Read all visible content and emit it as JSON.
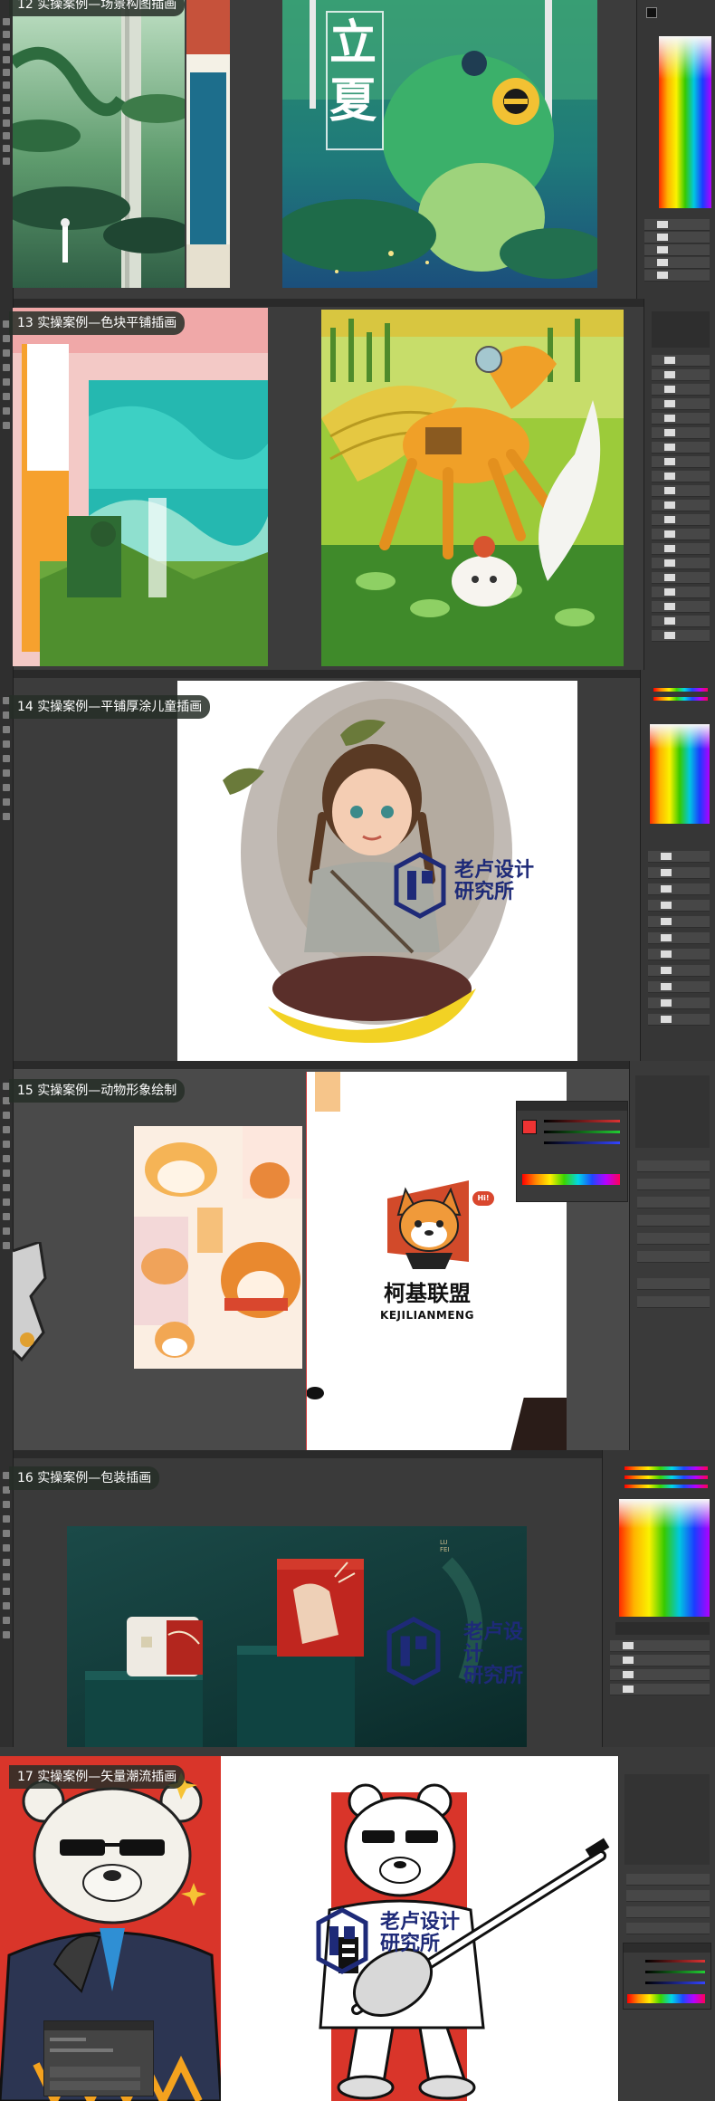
{
  "sections": [
    {
      "id": "s12",
      "label": "12 实操案例—场景构图插画"
    },
    {
      "id": "s13",
      "label": "13 实操案例—色块平铺插画"
    },
    {
      "id": "s14",
      "label": "14 实操案例—平铺厚涂儿童插画"
    },
    {
      "id": "s15",
      "label": "15 实操案例—动物形象绘制"
    },
    {
      "id": "s16",
      "label": "16 实操案例—包装插画"
    },
    {
      "id": "s17",
      "label": "17 实操案例—矢量潮流插画"
    }
  ],
  "poster12": {
    "title_line1": "立",
    "title_line2": "夏"
  },
  "watermark": {
    "line1": "老卢设计",
    "line2": "研究所"
  },
  "corgi": {
    "name_zh": "柯基联盟",
    "name_en": "KEJILIANMENG",
    "bubble": "Hi!"
  },
  "package16": {
    "brand": "LU\nFEI"
  },
  "colors": {
    "accent": "#1e2a78",
    "panel": "#363636",
    "toolbar": "#2f2f2f"
  }
}
